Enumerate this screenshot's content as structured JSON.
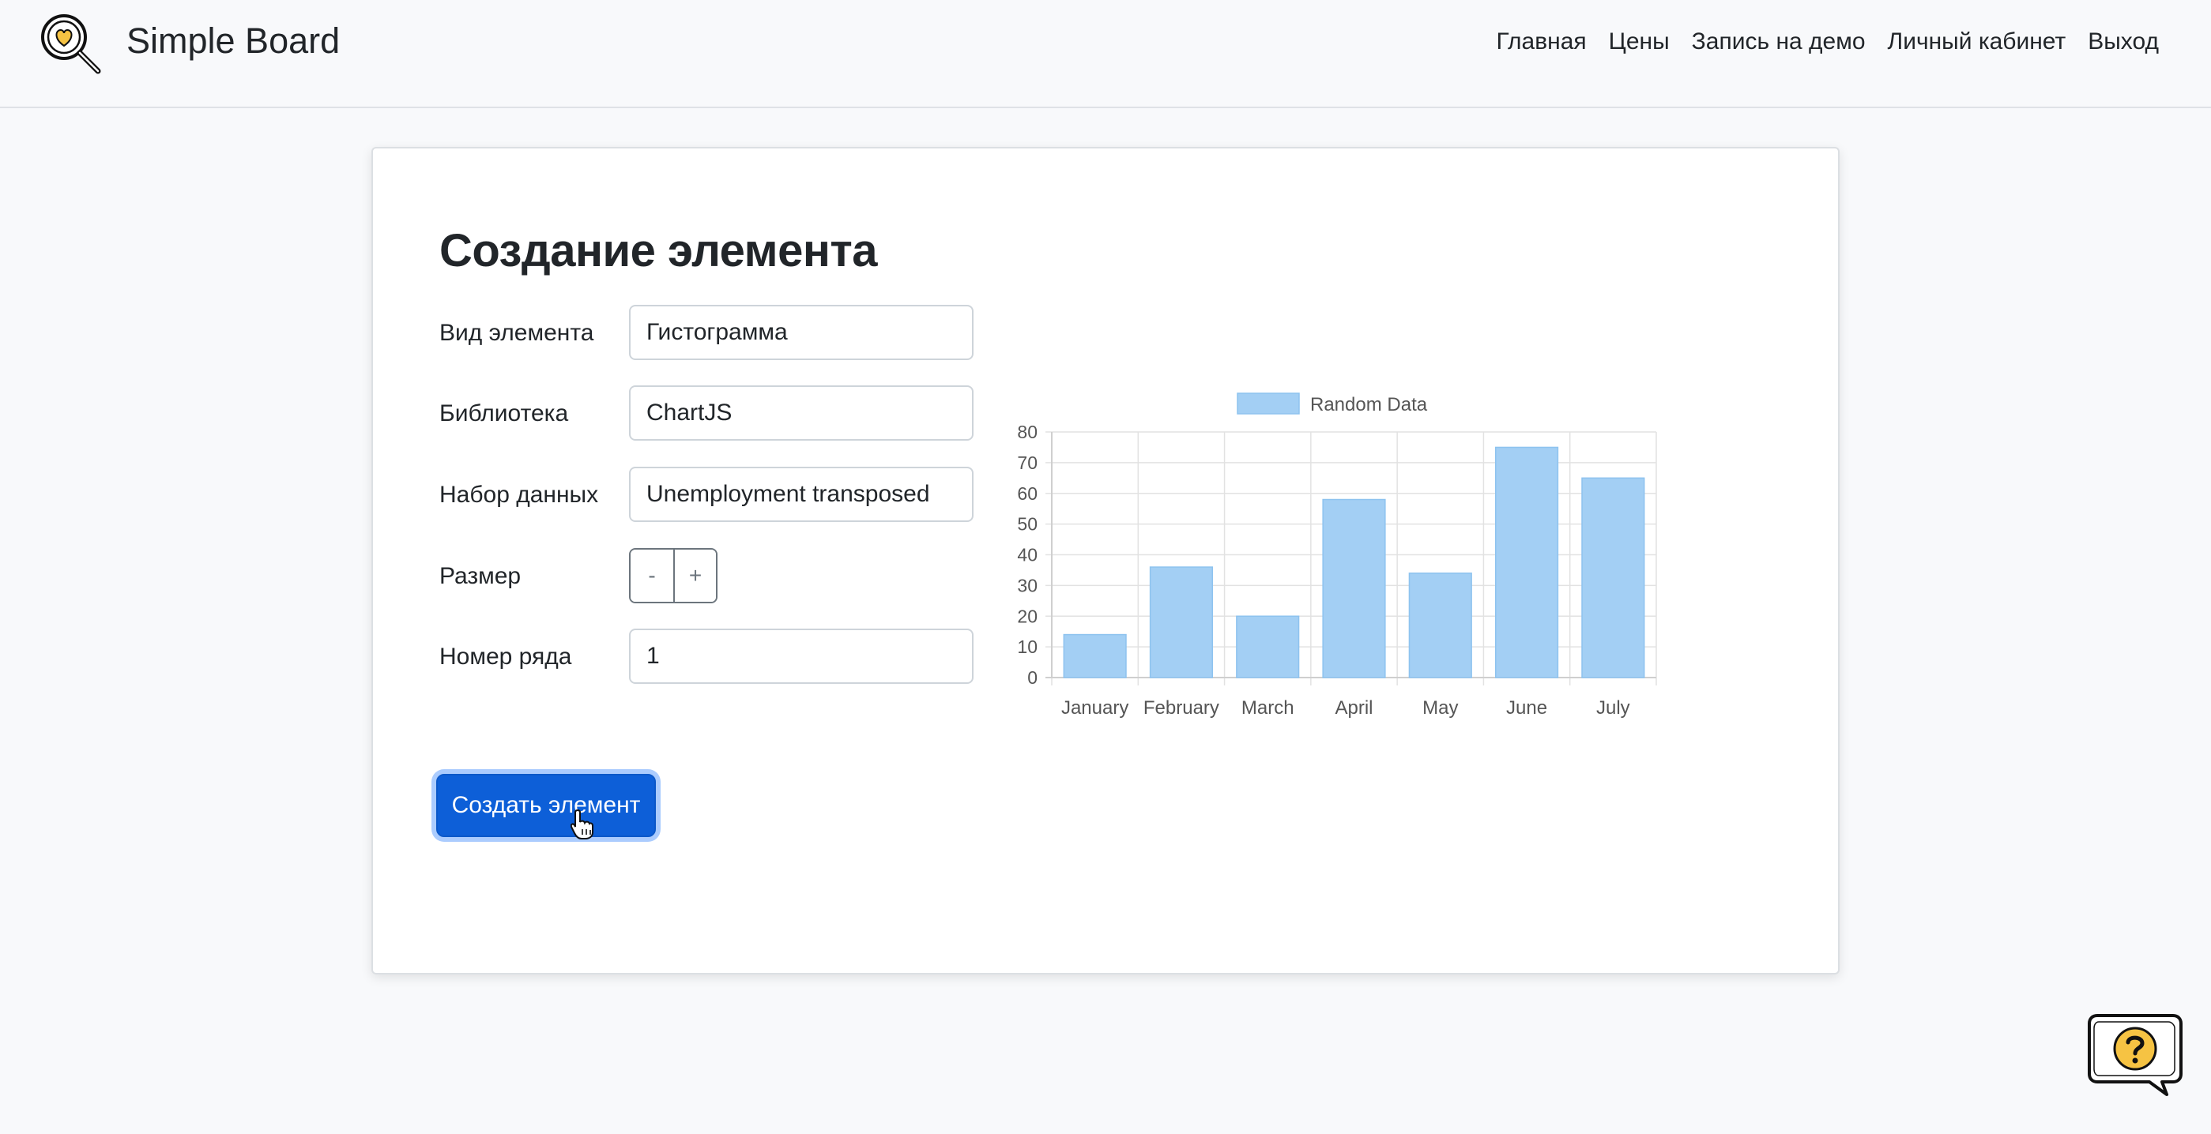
{
  "nav": {
    "brand": "Simple Board",
    "links": [
      "Главная",
      "Цены",
      "Запись на демо",
      "Личный кабинет",
      "Выход"
    ]
  },
  "form": {
    "title": "Создание элемента",
    "fields": {
      "element_type": {
        "label": "Вид элемента",
        "value": "Гистограмма"
      },
      "library": {
        "label": "Библиотека",
        "value": "ChartJS"
      },
      "dataset": {
        "label": "Набор данных",
        "value": "Unemployment transposed"
      },
      "size": {
        "label": "Размер",
        "minus": "-",
        "plus": "+"
      },
      "row_number": {
        "label": "Номер ряда",
        "value": "1"
      }
    },
    "submit_label": "Создать элемент"
  },
  "icons": {
    "logo": "magnifier-heart-icon",
    "help": "help-question-bubble-icon",
    "cursor": "hand-pointer-icon"
  },
  "colors": {
    "accent": "#0d5fd8",
    "bar_fill": "#a3cff4",
    "bar_border": "#8ec3ef",
    "logo_yellow": "#f6c343"
  },
  "chart_data": {
    "type": "bar",
    "categories": [
      "January",
      "February",
      "March",
      "April",
      "May",
      "June",
      "July"
    ],
    "series": [
      {
        "name": "Random Data",
        "values": [
          14,
          36,
          20,
          58,
          34,
          75,
          65
        ]
      }
    ],
    "yticks": [
      "0",
      "10",
      "20",
      "30",
      "40",
      "50",
      "60",
      "70",
      "80"
    ],
    "ylim": [
      0,
      80
    ],
    "grid": true,
    "legend": "top"
  }
}
